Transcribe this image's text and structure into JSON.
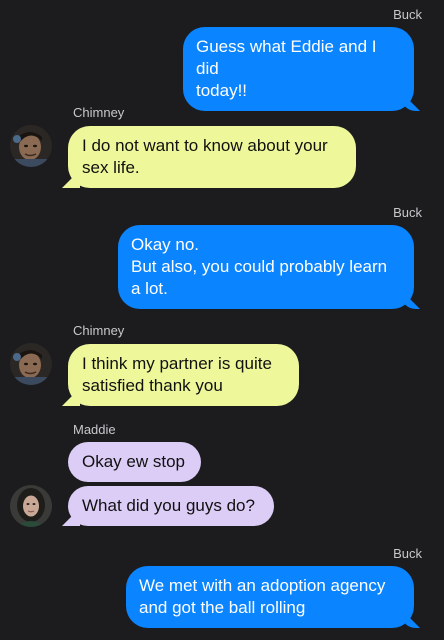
{
  "messages": [
    {
      "sender": "Buck",
      "text": "Guess what Eddie and I did\ntoday!!",
      "direction": "outgoing"
    },
    {
      "sender": "Chimney",
      "text": "I do not want to know about your\nsex life.",
      "direction": "incoming"
    },
    {
      "sender": "Buck",
      "text": "Okay no.\nBut also, you could probably learn\na lot.",
      "direction": "outgoing"
    },
    {
      "sender": "Chimney",
      "text": "I think my partner is quite\nsatisfied thank you",
      "direction": "incoming"
    },
    {
      "sender": "Maddie",
      "text": "Okay ew stop",
      "direction": "incoming"
    },
    {
      "sender": "Maddie",
      "text": "What did you guys do?",
      "direction": "incoming"
    },
    {
      "sender": "Buck",
      "text": "We met with an adoption agency\nand got the ball rolling",
      "direction": "outgoing"
    }
  ],
  "avatars": {
    "chimney": "chimney-avatar",
    "maddie": "maddie-avatar"
  },
  "colors": {
    "background": "#1c1c1e",
    "outgoing_bubble": "#0a84ff",
    "chimney_bubble": "#eef89a",
    "maddie_bubble": "#dccdf7",
    "name_label": "#c8c8cc"
  }
}
